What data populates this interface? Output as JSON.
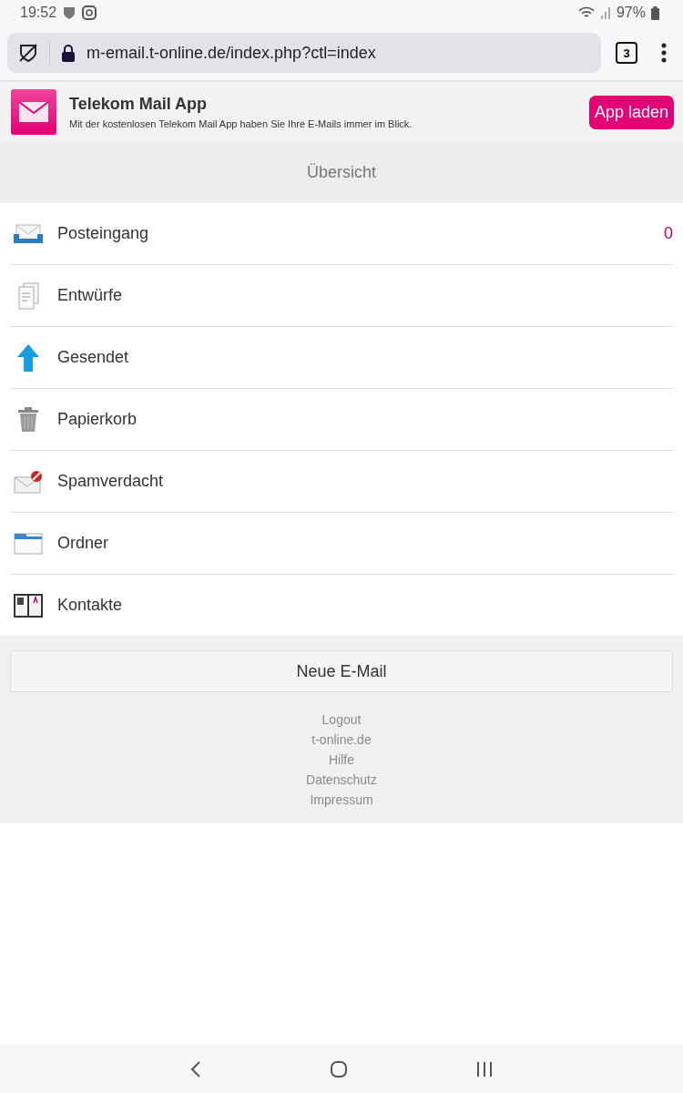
{
  "status_bar": {
    "time": "19:52",
    "battery": "97%"
  },
  "browser": {
    "url": "m-email.t-online.de/index.php?ctl=index",
    "tab_count": "3"
  },
  "app_banner": {
    "title": "Telekom Mail App",
    "text": "Mit der kostenlosen Telekom Mail App haben Sie Ihre E-Mails immer im Blick.",
    "button": "App laden"
  },
  "header": "Übersicht",
  "folders": [
    {
      "kind": "inbox",
      "label": "Posteingang",
      "count": "0"
    },
    {
      "kind": "drafts",
      "label": "Entwürfe"
    },
    {
      "kind": "sent",
      "label": "Gesendet"
    },
    {
      "kind": "trash",
      "label": "Papierkorb"
    },
    {
      "kind": "spam",
      "label": "Spamverdacht"
    },
    {
      "kind": "folders",
      "label": "Ordner"
    },
    {
      "kind": "contacts",
      "label": "Kontakte"
    }
  ],
  "new_mail_button": "Neue E-Mail",
  "footer_links": [
    "Logout",
    "t-online.de",
    "Hilfe",
    "Datenschutz",
    "Impressum"
  ]
}
